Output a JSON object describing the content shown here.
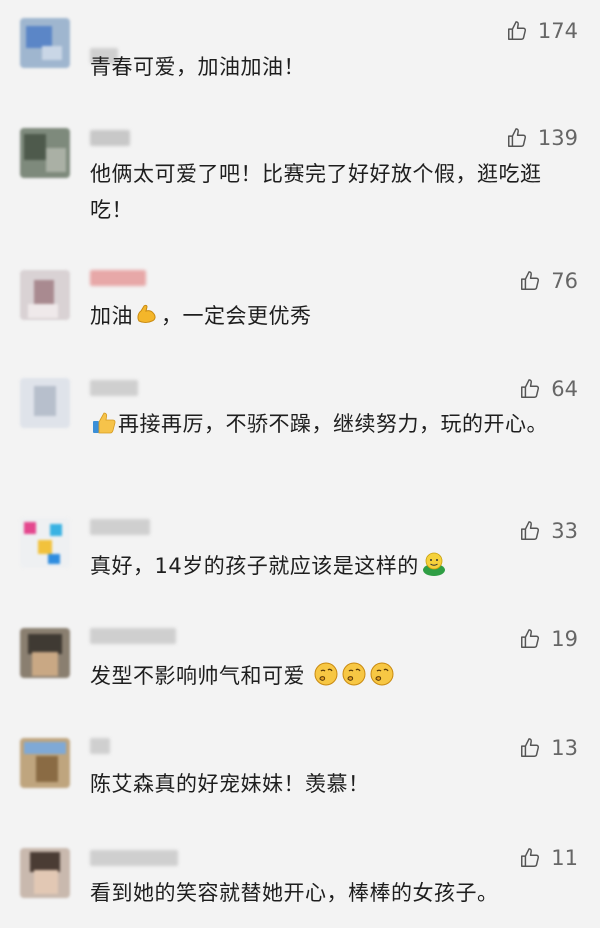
{
  "comments": [
    {
      "text": "青春可爱，加油加油！",
      "likes": "174"
    },
    {
      "text": "他俩太可爱了吧！比赛完了好好放个假，逛吃逛吃！",
      "likes": "139"
    },
    {
      "text_before": "加油",
      "text_after": "，一定会更优秀",
      "emoji": "muscle-emoji",
      "likes": "76"
    },
    {
      "text": "再接再厉，不骄不躁，继续努力，玩的开心。",
      "emoji": "thumbs-up-emoji",
      "likes": "64"
    },
    {
      "text": "真好，14岁的孩子就应该是这样的",
      "emoji": "green-face-emoji",
      "likes": "33"
    },
    {
      "text": "发型不影响帅气和可爱",
      "emoji": "thinking-face-emoji",
      "likes": "19"
    },
    {
      "text": "陈艾森真的好宠妹妹！羡慕！",
      "likes": "13"
    },
    {
      "text": "看到她的笑容就替她开心，棒棒的女孩子。",
      "likes": "11"
    }
  ],
  "colors": {
    "background": "#f3f3f3",
    "text": "#1e1e1e",
    "meta": "#666666"
  },
  "icons": {
    "like": "thumbs-up-outline-icon"
  }
}
